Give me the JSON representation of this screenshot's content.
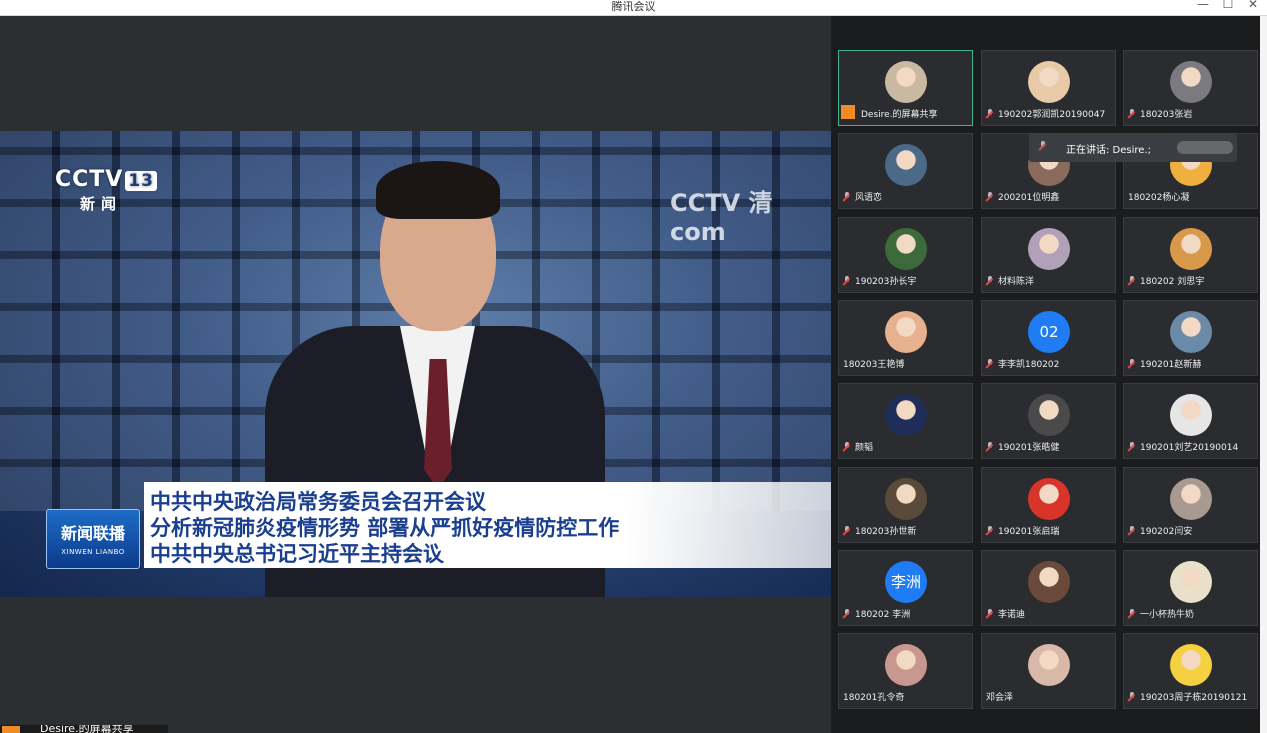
{
  "window": {
    "title": "腾讯会议",
    "minimize": "—",
    "maximize": "☐",
    "close": "✕"
  },
  "share_screen": {
    "cctv_logo": "CCTV",
    "channel_number": "13",
    "channel_name": "新闻",
    "watermark": "CCTV 清 com",
    "program_logo_cn": "新闻联播",
    "program_logo_en": "XINWEN LIANBO",
    "headlines": [
      "中共中央政治局常务委员会召开会议",
      "分析新冠肺炎疫情形势 部署从严抓好疫情防控工作",
      "中共中央总书记习近平主持会议"
    ],
    "presenter_label": "Desire.的屏幕共享"
  },
  "speaking_indicator": {
    "text": "正在讲话: Desire.;"
  },
  "participants": [
    {
      "name": "Desire.的屏幕共享",
      "avatar": "#c9b9a3",
      "active": true,
      "sharing": true
    },
    {
      "name": "190202郭润凯20190047",
      "avatar": "#e8c9a8",
      "muted": true
    },
    {
      "name": "180203张岩",
      "avatar": "#7a7a80",
      "muted": true
    },
    {
      "name": "风语恋",
      "avatar": "#4a6a88",
      "muted": true
    },
    {
      "name": "200201位明鑫",
      "avatar": "#8a6a5a",
      "muted": true
    },
    {
      "name": "180202杨心凝",
      "avatar": "#f0b040",
      "muted": false
    },
    {
      "name": "190203孙长宇",
      "avatar": "#3d6a3a",
      "muted": true
    },
    {
      "name": "材料陈洋",
      "avatar": "#b0a0b8",
      "muted": true
    },
    {
      "name": "180202 刘思宇",
      "avatar": "#d89a4a",
      "muted": true
    },
    {
      "name": "180203王艳博",
      "avatar": "#e7b08e",
      "muted": false
    },
    {
      "name": "李李凯180202",
      "avatar_text": "02",
      "avatar": "#1f7cf5",
      "muted": true
    },
    {
      "name": "190201赵新赫",
      "avatar": "#6a8aa8",
      "muted": true
    },
    {
      "name": "颜韬",
      "avatar": "#1e2e58",
      "muted": true
    },
    {
      "name": "190201张皓健",
      "avatar": "#4a4a4a",
      "muted": true
    },
    {
      "name": "190201刘艺20190014",
      "avatar": "#e6e6e6",
      "muted": true
    },
    {
      "name": "180203孙世新",
      "avatar": "#5a4a3a",
      "muted": true
    },
    {
      "name": "190201张启瑞",
      "avatar": "#d8342a",
      "muted": true
    },
    {
      "name": "190202闫安",
      "avatar": "#a89a90",
      "muted": true
    },
    {
      "name": "180202 李洲",
      "avatar_text": "李洲",
      "avatar": "#1f7cf5",
      "muted": true
    },
    {
      "name": "李诺迪",
      "avatar": "#6a4a3a",
      "muted": true
    },
    {
      "name": "一小杯热牛奶",
      "avatar": "#e8e0c8",
      "muted": true
    },
    {
      "name": "180201孔令奇",
      "avatar": "#c89890",
      "muted": false
    },
    {
      "name": "邓会泽",
      "avatar": "#d8b8a8",
      "muted": false
    },
    {
      "name": "190203周子栋20190121",
      "avatar": "#f5d040",
      "muted": true
    }
  ]
}
